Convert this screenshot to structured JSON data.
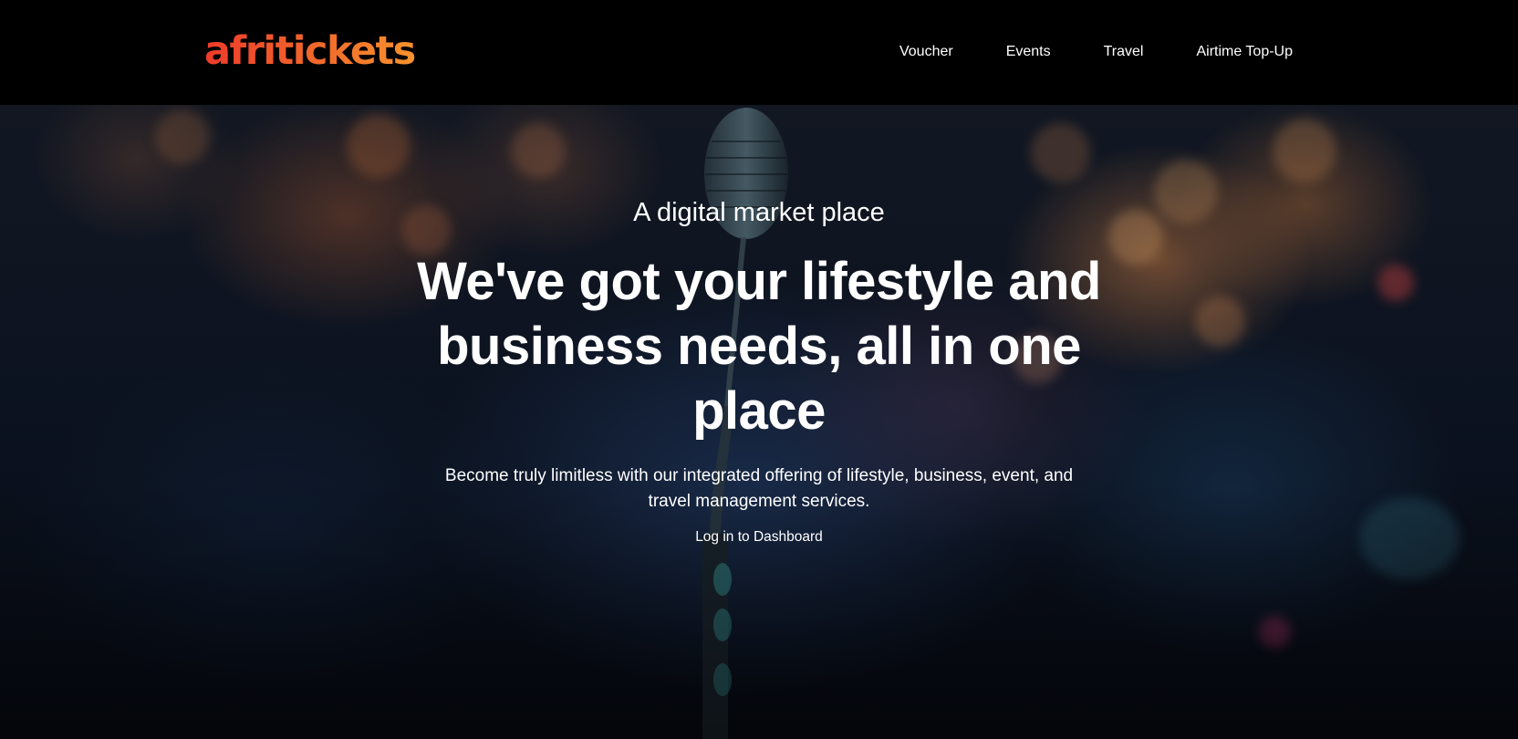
{
  "header": {
    "logo_text": "afritickets",
    "nav": [
      {
        "label": "Voucher"
      },
      {
        "label": "Events"
      },
      {
        "label": "Travel"
      },
      {
        "label": "Airtime Top-Up"
      }
    ]
  },
  "hero": {
    "subtitle": "A digital market place",
    "headline": "We've got your lifestyle and business needs, all in one place",
    "description": "Become truly limitless with our integrated offering of lifestyle, business, event, and travel management services.",
    "cta_label": "Log in to Dashboard",
    "background": "concert-microphone-photo"
  },
  "colors": {
    "brand_gradient_start": "#ee3b2b",
    "brand_gradient_end": "#f7932c",
    "header_background": "#000000",
    "text": "#ffffff"
  }
}
